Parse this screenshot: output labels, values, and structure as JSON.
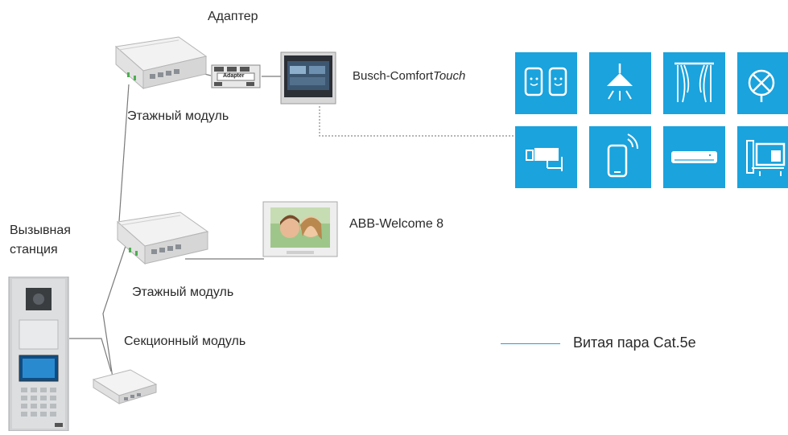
{
  "labels": {
    "adapter": "Адаптер",
    "floor_module_top": "Этажный модуль",
    "floor_module_mid": "Этажный модуль",
    "section_module": "Секционный модуль",
    "call_station_line1": "Вызывная",
    "call_station_line2": "станция",
    "busch_comfort_prefix": "Busch-Comfort",
    "busch_comfort_suffix": "Touch",
    "abb_welcome": "ABB-Welcome 8",
    "adapter_device_text": "Adapter",
    "legend_text": "Витая пара Cat.5e"
  },
  "colors": {
    "accent": "#1aa3dd",
    "wire": "#7a7a7a"
  },
  "tiles": [
    {
      "name": "phones-icon"
    },
    {
      "name": "ceiling-lamp-icon"
    },
    {
      "name": "curtains-icon"
    },
    {
      "name": "fan-icon"
    },
    {
      "name": "camera-icon"
    },
    {
      "name": "smartphone-wifi-icon"
    },
    {
      "name": "air-conditioner-icon"
    },
    {
      "name": "sunblind-icon"
    }
  ]
}
